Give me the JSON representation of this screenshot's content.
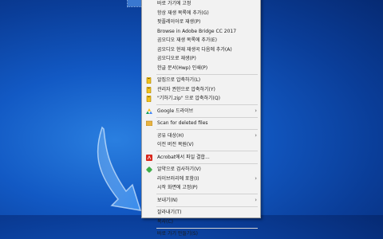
{
  "menu": {
    "items": [
      {
        "label": "바로 가기에 고정"
      },
      {
        "label": "항상 재생 목록에 추가(G)"
      },
      {
        "label": "팟플레이어로 재생(P)"
      },
      {
        "label": "Browse in Adobe Bridge CC 2017"
      },
      {
        "label": "곰오디오 재생 목록에 추가(E)"
      },
      {
        "label": "곰오디오 현재 재생곡 다음에 추가(A)"
      },
      {
        "label": "곰오디오로 재생(P)"
      },
      {
        "label": "한글 문서(Hwp) 인쇄(P)"
      },
      {
        "sep": true
      },
      {
        "label": "알집으로 압축하기(L)",
        "icon": "alzip-icon"
      },
      {
        "label": "관리자 권한으로 압축하기(Y)",
        "icon": "alzip-icon"
      },
      {
        "label": "\"기하기.zip\" 으로 압축하기(Q)",
        "icon": "alzip-icon"
      },
      {
        "sep": true
      },
      {
        "label": "Google 드라이브",
        "icon": "google-drive-icon",
        "sub": true
      },
      {
        "sep": true
      },
      {
        "label": "Scan for deleted files",
        "icon": "scan-icon"
      },
      {
        "sep": true
      },
      {
        "label": "공유 대상(H)",
        "sub": true
      },
      {
        "label": "이전 버전 복원(V)"
      },
      {
        "sep": true
      },
      {
        "label": "Acrobat에서 파일 결합...",
        "icon": "acrobat-icon"
      },
      {
        "sep": true
      },
      {
        "label": "알약으로 검사하기(V)",
        "icon": "alyac-icon"
      },
      {
        "label": "라이브러리에 포함(I)",
        "sub": true
      },
      {
        "label": "시작 화면에 고정(P)"
      },
      {
        "sep": true
      },
      {
        "label": "보내기(N)",
        "sub": true
      },
      {
        "sep": true
      },
      {
        "label": "잘라내기(T)"
      },
      {
        "label": "복사(C)"
      },
      {
        "sep": true
      },
      {
        "label": "바로 가기 만들기(S)"
      }
    ]
  },
  "colors": {
    "menu_bg": "#f2f2f2",
    "desktop": "#1259c4",
    "arrow": "#2e86e8"
  }
}
